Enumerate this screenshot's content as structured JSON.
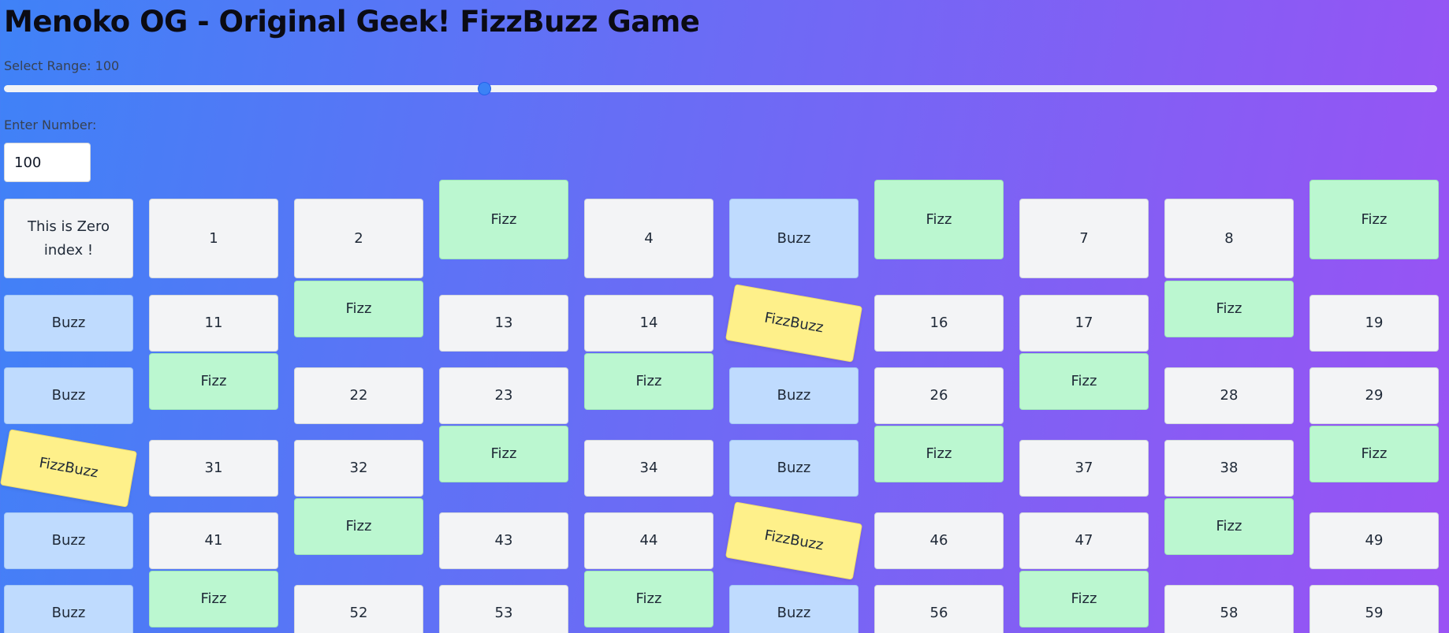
{
  "header": {
    "title": "Menoko OG - Original Geek! FizzBuzz Game"
  },
  "range": {
    "label": "Select Range: 100",
    "value": 100,
    "fraction": 0.335
  },
  "number": {
    "label": "Enter Number:",
    "value": "100"
  },
  "grid": {
    "cells": [
      {
        "text": "This is Zero index !",
        "kind": "plain"
      },
      {
        "text": "1",
        "kind": "plain"
      },
      {
        "text": "2",
        "kind": "plain"
      },
      {
        "text": "Fizz",
        "kind": "fizz"
      },
      {
        "text": "4",
        "kind": "plain"
      },
      {
        "text": "Buzz",
        "kind": "buzz"
      },
      {
        "text": "Fizz",
        "kind": "fizz"
      },
      {
        "text": "7",
        "kind": "plain"
      },
      {
        "text": "8",
        "kind": "plain"
      },
      {
        "text": "Fizz",
        "kind": "fizz"
      },
      {
        "text": "Buzz",
        "kind": "buzz"
      },
      {
        "text": "11",
        "kind": "plain"
      },
      {
        "text": "Fizz",
        "kind": "fizz"
      },
      {
        "text": "13",
        "kind": "plain"
      },
      {
        "text": "14",
        "kind": "plain"
      },
      {
        "text": "FizzBuzz",
        "kind": "fizzbuzz"
      },
      {
        "text": "16",
        "kind": "plain"
      },
      {
        "text": "17",
        "kind": "plain"
      },
      {
        "text": "Fizz",
        "kind": "fizz"
      },
      {
        "text": "19",
        "kind": "plain"
      },
      {
        "text": "Buzz",
        "kind": "buzz"
      },
      {
        "text": "Fizz",
        "kind": "fizz"
      },
      {
        "text": "22",
        "kind": "plain"
      },
      {
        "text": "23",
        "kind": "plain"
      },
      {
        "text": "Fizz",
        "kind": "fizz"
      },
      {
        "text": "Buzz",
        "kind": "buzz"
      },
      {
        "text": "26",
        "kind": "plain"
      },
      {
        "text": "Fizz",
        "kind": "fizz"
      },
      {
        "text": "28",
        "kind": "plain"
      },
      {
        "text": "29",
        "kind": "plain"
      },
      {
        "text": "FizzBuzz",
        "kind": "fizzbuzz"
      },
      {
        "text": "31",
        "kind": "plain"
      },
      {
        "text": "32",
        "kind": "plain"
      },
      {
        "text": "Fizz",
        "kind": "fizz"
      },
      {
        "text": "34",
        "kind": "plain"
      },
      {
        "text": "Buzz",
        "kind": "buzz"
      },
      {
        "text": "Fizz",
        "kind": "fizz"
      },
      {
        "text": "37",
        "kind": "plain"
      },
      {
        "text": "38",
        "kind": "plain"
      },
      {
        "text": "Fizz",
        "kind": "fizz"
      },
      {
        "text": "Buzz",
        "kind": "buzz"
      },
      {
        "text": "41",
        "kind": "plain"
      },
      {
        "text": "Fizz",
        "kind": "fizz"
      },
      {
        "text": "43",
        "kind": "plain"
      },
      {
        "text": "44",
        "kind": "plain"
      },
      {
        "text": "FizzBuzz",
        "kind": "fizzbuzz"
      },
      {
        "text": "46",
        "kind": "plain"
      },
      {
        "text": "47",
        "kind": "plain"
      },
      {
        "text": "Fizz",
        "kind": "fizz"
      },
      {
        "text": "49",
        "kind": "plain"
      },
      {
        "text": "Buzz",
        "kind": "buzz"
      },
      {
        "text": "Fizz",
        "kind": "fizz"
      },
      {
        "text": "52",
        "kind": "plain"
      },
      {
        "text": "53",
        "kind": "plain"
      },
      {
        "text": "Fizz",
        "kind": "fizz"
      },
      {
        "text": "Buzz",
        "kind": "buzz"
      },
      {
        "text": "56",
        "kind": "plain"
      },
      {
        "text": "Fizz",
        "kind": "fizz"
      },
      {
        "text": "58",
        "kind": "plain"
      },
      {
        "text": "59",
        "kind": "plain"
      }
    ]
  },
  "colors": {
    "plain": "#f3f4f6",
    "fizz": "#bbf7d0",
    "buzz": "#bfdbfe",
    "fizzbuzz": "#fef08a",
    "accent": "#3b82f6"
  }
}
